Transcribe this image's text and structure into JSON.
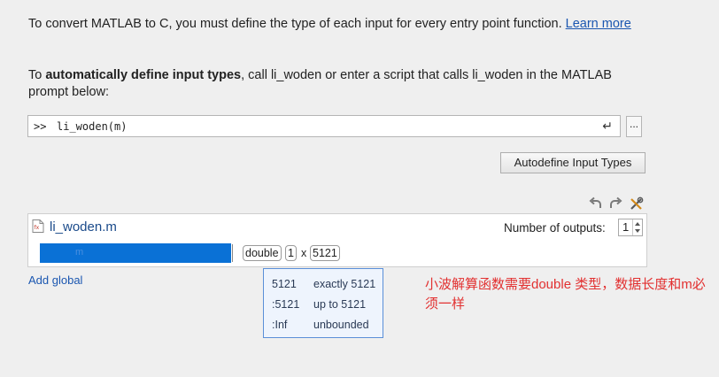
{
  "intro": {
    "text": "To convert MATLAB to C, you must define the type of each input for every entry point function. ",
    "link": "Learn more"
  },
  "auto": {
    "prefix": "To ",
    "bold": "automatically define input types",
    "suffix": ", call li_woden or enter a script that calls li_woden in the MATLAB prompt below:"
  },
  "command": {
    "prompt": ">>",
    "value": "li_woden(m)",
    "enter_glyph": "↵",
    "more_label": "..."
  },
  "autodefine_label": "Autodefine Input Types",
  "file": {
    "name": "li_woden.m",
    "outputs_label": "Number of outputs:",
    "outputs_value": "1"
  },
  "input": {
    "name": "m",
    "type": "double",
    "dim1": "1",
    "times": "x",
    "dim2": "5121"
  },
  "add_global": "Add global",
  "size_options": [
    {
      "value": "5121",
      "desc": "exactly 5121"
    },
    {
      "value": ":5121",
      "desc": "up to 5121"
    },
    {
      "value": ":Inf",
      "desc": "unbounded"
    }
  ],
  "note": "小波解算函数需要double 类型，数据长度和m必须一样",
  "colors": {
    "accent": "#0a71d6",
    "link": "#1a56b0",
    "note": "#e23030",
    "popup_bg": "#eef4fd"
  }
}
